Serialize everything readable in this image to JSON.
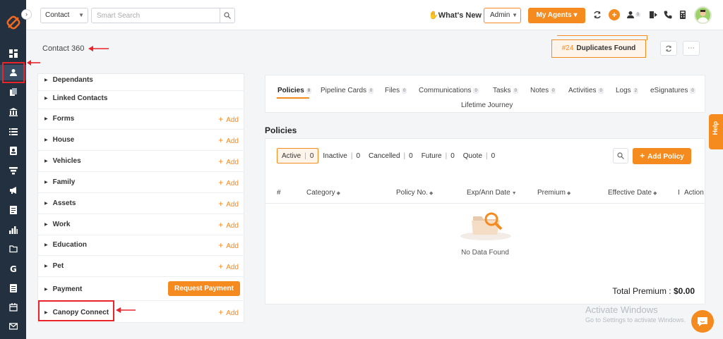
{
  "topbar": {
    "module_select": "Contact",
    "search_placeholder": "Smart Search",
    "whats_new": "What's New",
    "admin_select": "Admin",
    "my_agents": "My Agents",
    "user_badge": "0"
  },
  "header": {
    "page_title": "Contact 360",
    "duplicates_number": "#24",
    "duplicates_label": "Duplicates Found"
  },
  "left_panel": {
    "add_label": "Add",
    "request_payment": "Request Payment",
    "rows": [
      {
        "label": "Dependants"
      },
      {
        "label": "Linked Contacts"
      },
      {
        "label": "Forms"
      },
      {
        "label": "House"
      },
      {
        "label": "Vehicles"
      },
      {
        "label": "Family"
      },
      {
        "label": "Assets"
      },
      {
        "label": "Work"
      },
      {
        "label": "Education"
      },
      {
        "label": "Pet"
      },
      {
        "label": "Payment"
      },
      {
        "label": "Canopy Connect"
      }
    ]
  },
  "tabs": [
    {
      "label": "Policies",
      "count": "0"
    },
    {
      "label": "Pipeline Cards",
      "count": "0"
    },
    {
      "label": "Files",
      "count": "0"
    },
    {
      "label": "Communications",
      "count": "0"
    },
    {
      "label": "Tasks",
      "count": "0"
    },
    {
      "label": "Notes",
      "count": "0"
    },
    {
      "label": "Activities",
      "count": "0"
    },
    {
      "label": "Logs",
      "count": "2"
    },
    {
      "label": "eSignatures",
      "count": "0"
    },
    {
      "label": "Lifetime Journey"
    }
  ],
  "policies": {
    "heading": "Policies",
    "filters": [
      {
        "label": "Active",
        "count": "0"
      },
      {
        "label": "Inactive",
        "count": "0"
      },
      {
        "label": "Cancelled",
        "count": "0"
      },
      {
        "label": "Future",
        "count": "0"
      },
      {
        "label": "Quote",
        "count": "0"
      }
    ],
    "add_policy": "Add Policy",
    "columns": [
      "#",
      "Category",
      "Policy No.",
      "Exp/Ann Date",
      "Premium",
      "Effective Date",
      "I",
      "Action"
    ],
    "empty_text": "No Data Found",
    "total_label": "Total Premium : ",
    "total_value": "$0.00"
  },
  "help": "Help",
  "watermark": {
    "line1": "Activate Windows",
    "line2": "Go to Settings to activate Windows."
  },
  "colors": {
    "accent": "#f58a1f",
    "sidebar": "#22303f",
    "annotation": "#e8252b"
  }
}
